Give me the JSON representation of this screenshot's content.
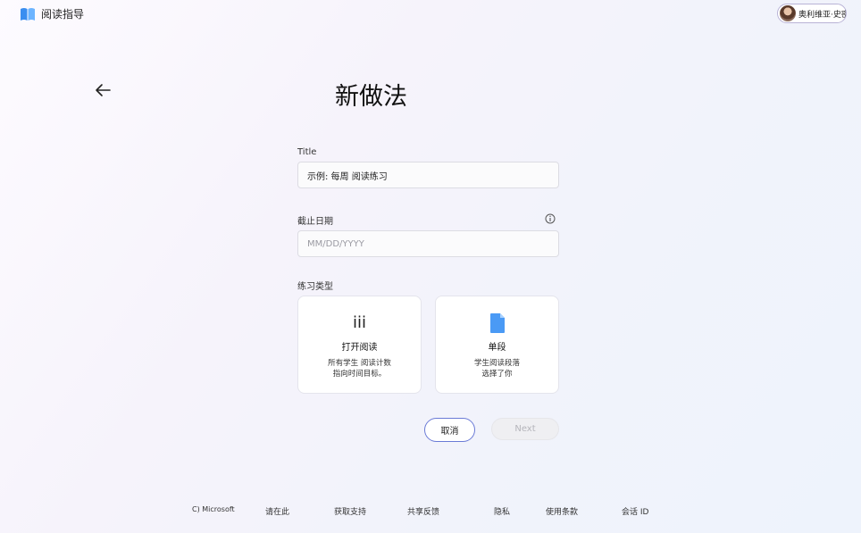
{
  "header": {
    "app_title": "阅读指导",
    "user_name": "奥利维亚·史密斯"
  },
  "page": {
    "title": "新做法"
  },
  "form": {
    "title_label": "Title",
    "title_value": "示例: 每周 阅读练习",
    "due_date_label": "截止日期",
    "due_date_placeholder": "MM/DD/YYYY",
    "practice_type_label": "练习类型",
    "cards": [
      {
        "icon": "iii",
        "icon_name": "open-reading-icon",
        "title": "打开阅读",
        "desc": "所有学生 阅读计数\n指向时间目标。"
      },
      {
        "icon_name": "document-icon",
        "title": "单段",
        "desc": "学生阅读段落\n选择了你"
      }
    ]
  },
  "actions": {
    "cancel": "取消",
    "next": "Next"
  },
  "footer": {
    "copyright": "C) Microsoft",
    "items": [
      "请在此",
      "获取支持",
      "共享反馈",
      "隐私",
      "使用条款",
      "会话 ID"
    ]
  },
  "colors": {
    "accent": "#6a7ad6",
    "logo": "#3a8ef0"
  }
}
